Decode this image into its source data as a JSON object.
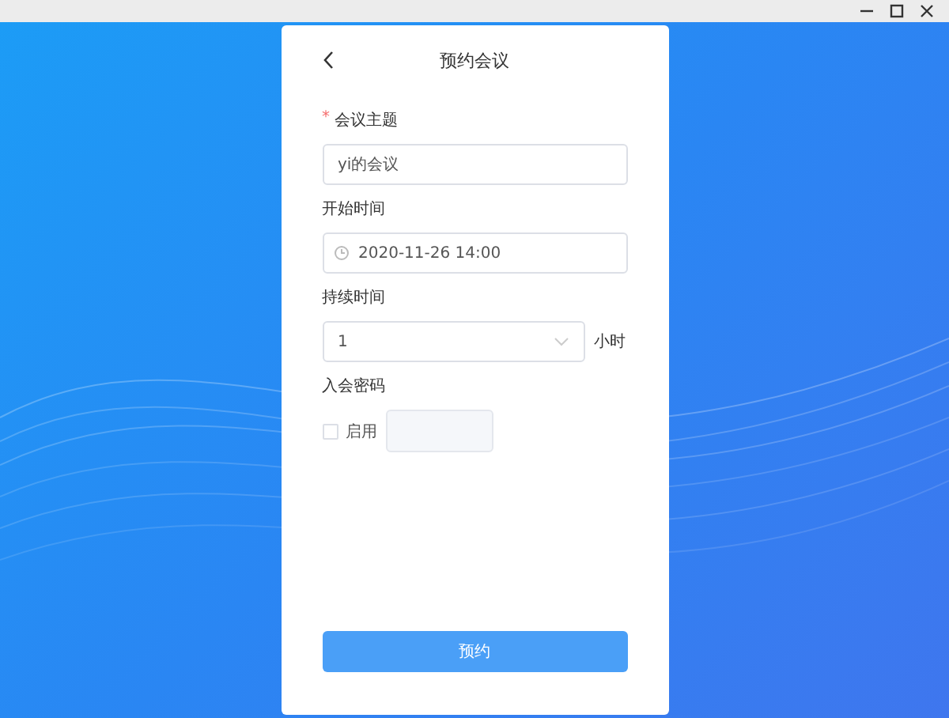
{
  "dialog": {
    "title": "预约会议"
  },
  "fields": [
    {
      "kind": "text",
      "label": "会议主题",
      "required_mark": "*",
      "value": "yi的会议"
    },
    {
      "kind": "datetime",
      "label": "开始时间",
      "value": "2020-11-26 14:00"
    },
    {
      "kind": "select",
      "label": "持续时间",
      "value": "1",
      "unit": "小时"
    },
    {
      "kind": "password",
      "label": "入会密码",
      "checkbox_label": "启用",
      "checked": false
    }
  ],
  "submit_button": "预约"
}
